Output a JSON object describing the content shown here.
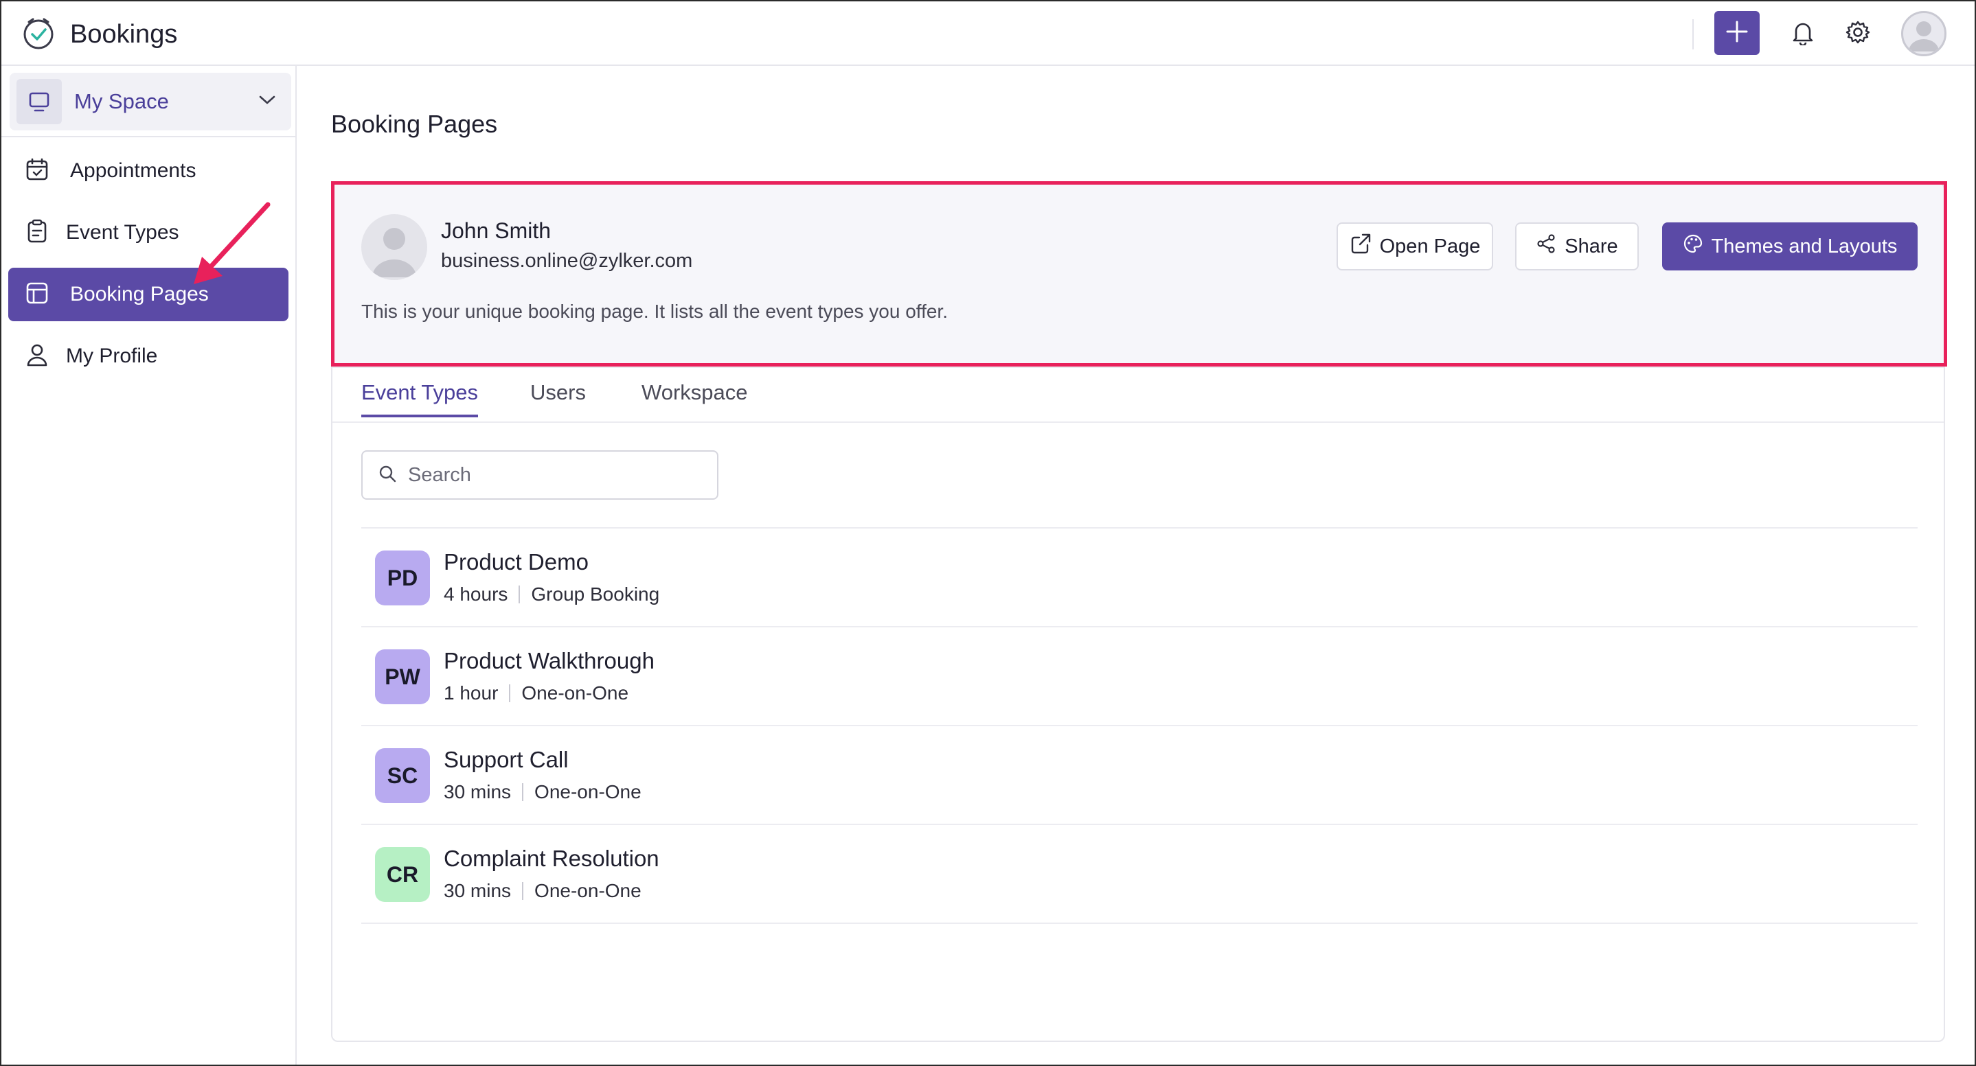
{
  "app": {
    "title": "Bookings"
  },
  "sidebar": {
    "space_label": "My Space",
    "items": [
      {
        "label": "Appointments",
        "icon": "calendar-icon"
      },
      {
        "label": "Event Types",
        "icon": "clipboard-icon"
      },
      {
        "label": "Booking Pages",
        "icon": "layout-icon",
        "active": true
      },
      {
        "label": "My Profile",
        "icon": "user-icon"
      }
    ]
  },
  "main": {
    "page_title": "Booking Pages",
    "profile": {
      "name": "John Smith",
      "email": "business.online@zylker.com",
      "description": "This is your unique booking page. It lists all the event types you offer."
    },
    "buttons": {
      "open_page": "Open Page",
      "share": "Share",
      "themes": "Themes and Layouts"
    },
    "tabs": [
      "Event Types",
      "Users",
      "Workspace"
    ],
    "search": {
      "placeholder": "Search",
      "value": ""
    },
    "events": [
      {
        "initials": "PD",
        "title": "Product Demo",
        "duration": "4 hours",
        "type": "Group Booking",
        "color": "#b8aaf0"
      },
      {
        "initials": "PW",
        "title": "Product Walkthrough",
        "duration": "1 hour",
        "type": "One-on-One",
        "color": "#b8aaf0"
      },
      {
        "initials": "SC",
        "title": "Support Call",
        "duration": "30 mins",
        "type": "One-on-One",
        "color": "#b8aaf0"
      },
      {
        "initials": "CR",
        "title": "Complaint Resolution",
        "duration": "30 mins",
        "type": "One-on-One",
        "color": "#b6f0c4"
      }
    ]
  },
  "colors": {
    "accent": "#5b4aa6",
    "highlight": "#e8215b"
  }
}
